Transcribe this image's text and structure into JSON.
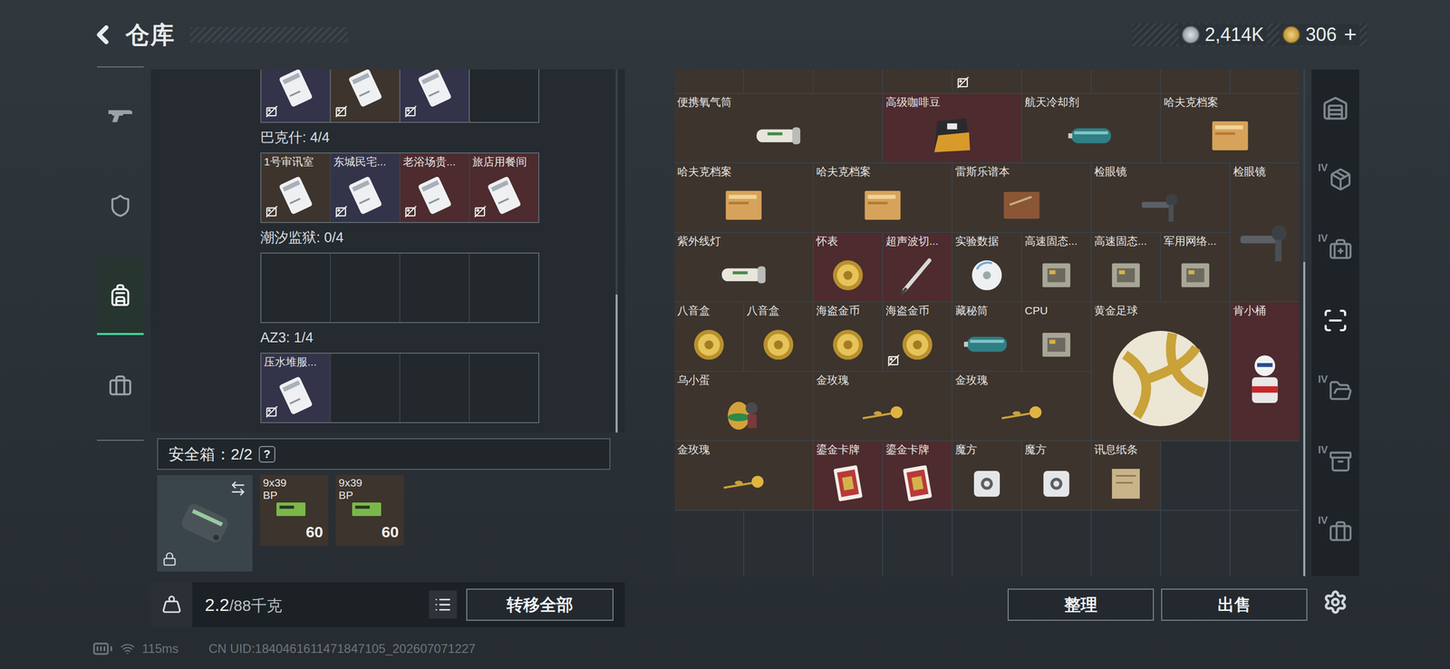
{
  "header": {
    "title": "仓库"
  },
  "currency": [
    {
      "value": "2,414K",
      "kind": "silver"
    },
    {
      "value": "306",
      "kind": "gold",
      "action": "+"
    }
  ],
  "left_tabs": [
    {
      "selected": false
    },
    {
      "selected": false
    },
    {
      "selected": true
    },
    {
      "selected": false
    }
  ],
  "keycards": {
    "partial_row": [
      {
        "kind": "card",
        "color": "#33344a",
        "untradeable": true
      },
      {
        "kind": "card",
        "color": "#3d342d",
        "untradeable": true
      },
      {
        "kind": "card",
        "color": "#33344a",
        "untradeable": true
      },
      {
        "kind": "empty"
      }
    ],
    "groups": [
      {
        "title": "巴克什: 4/4",
        "slots": [
          {
            "kind": "card",
            "name": "1号审讯室",
            "color": "#3d342d",
            "untradeable": true
          },
          {
            "kind": "card",
            "name": "东城民宅...",
            "color": "#33344a",
            "untradeable": true
          },
          {
            "kind": "card",
            "name": "老浴场贵...",
            "color": "#4d2b2e",
            "untradeable": true
          },
          {
            "kind": "card",
            "name": "旅店用餐间",
            "color": "#4d2b2e",
            "untradeable": true
          }
        ]
      },
      {
        "title": "潮汐监狱: 0/4",
        "slots": [
          {
            "kind": "empty"
          },
          {
            "kind": "empty"
          },
          {
            "kind": "empty"
          },
          {
            "kind": "empty"
          }
        ]
      },
      {
        "title": "AZ3: 1/4",
        "slots": [
          {
            "kind": "card",
            "name": "压水堆服...",
            "color": "#33344a",
            "untradeable": true
          },
          {
            "kind": "empty"
          },
          {
            "kind": "empty"
          },
          {
            "kind": "empty"
          }
        ]
      }
    ],
    "scroll": {
      "thumb_start": 0.62,
      "thumb_end": 1
    }
  },
  "safe_box": {
    "title": "安全箱：2/2",
    "help": "?",
    "locked": true,
    "items": [
      {
        "name": "9x39 BP",
        "count": "60"
      },
      {
        "name": "9x39 BP",
        "count": "60"
      }
    ]
  },
  "inventory_bar": {
    "weight": "2.2",
    "capacity": "/88千克",
    "transfer": "转移全部"
  },
  "stash": {
    "partial_row": [
      {
        "color": "#3d342d",
        "untradeable": false
      },
      {
        "color": "#3d342d",
        "untradeable": false
      },
      {
        "color": "#3d342d",
        "untradeable": false
      },
      {
        "color": "#3d342d",
        "untradeable": false
      },
      {
        "color": "#3d342d",
        "untradeable": true
      },
      {
        "color": "#3d342d",
        "untradeable": false
      },
      {
        "color": "#3d342d",
        "untradeable": false
      },
      {
        "color": "#3d342d",
        "untradeable": false
      },
      {
        "color": "#3d342d",
        "untradeable": false
      }
    ],
    "items": [
      {
        "name": "便携氧气筒",
        "kind": "cylinder",
        "color": "#3d342d",
        "untradeable": false
      },
      {
        "name": "高级咖啡豆",
        "kind": "bag",
        "color": "#4d2b2e",
        "untradeable": false
      },
      {
        "name": "航天冷却剂",
        "kind": "tank",
        "color": "#3d342d",
        "untradeable": false
      },
      {
        "name": "哈夫克档案",
        "kind": "folder",
        "color": "#3d342d",
        "untradeable": false
      },
      {
        "name": "哈夫克档案",
        "kind": "folder",
        "color": "#3d342d",
        "untradeable": false
      },
      {
        "name": "哈夫克档案",
        "kind": "folder",
        "color": "#3d342d",
        "untradeable": false
      },
      {
        "name": "雷斯乐谱本",
        "kind": "book",
        "color": "#3d342d",
        "untradeable": false
      },
      {
        "name": "检眼镜",
        "kind": "scope",
        "color": "#3d342d",
        "untradeable": false
      },
      {
        "name": "检眼镜",
        "kind": "scope",
        "color": "#3d342d",
        "untradeable": false
      },
      {
        "name": "紫外线灯",
        "kind": "cylinder",
        "color": "#3d342d",
        "untradeable": false
      },
      {
        "name": "怀表",
        "kind": "coin",
        "color": "#4d2b2e",
        "untradeable": false
      },
      {
        "name": "超声波切...",
        "kind": "pen",
        "color": "#4d2b2e",
        "untradeable": false
      },
      {
        "name": "实验数据",
        "kind": "disc",
        "color": "#3d342d",
        "untradeable": false
      },
      {
        "name": "高速固态...",
        "kind": "chip",
        "color": "#3d342d",
        "untradeable": false
      },
      {
        "name": "高速固态...",
        "kind": "chip",
        "color": "#3d342d",
        "untradeable": false
      },
      {
        "name": "军用网络...",
        "kind": "chip",
        "color": "#3d342d",
        "untradeable": false
      },
      {
        "name": "八音盒",
        "kind": "coin",
        "color": "#3d342d",
        "untradeable": false
      },
      {
        "name": "八音盒",
        "kind": "coin",
        "color": "#3d342d",
        "untradeable": false
      },
      {
        "name": "海盗金币",
        "kind": "coin",
        "color": "#3d342d",
        "untradeable": false
      },
      {
        "name": "海盗金币",
        "kind": "coin",
        "color": "#3d342d",
        "untradeable": true
      },
      {
        "name": "藏秘筒",
        "kind": "tank",
        "color": "#3d342d",
        "untradeable": false
      },
      {
        "name": "CPU",
        "kind": "chip",
        "color": "#3d342d",
        "untradeable": false
      },
      {
        "name": "黄金足球",
        "kind": "ball",
        "color": "#3d342d",
        "untradeable": false
      },
      {
        "name": "肯小桶",
        "kind": "figure",
        "color": "#4d2b2e",
        "untradeable": false
      },
      {
        "name": "乌小蛋",
        "kind": "egg",
        "color": "#3d342d",
        "untradeable": false
      },
      {
        "name": "金玫瑰",
        "kind": "rose",
        "color": "#3d342d",
        "untradeable": false
      },
      {
        "name": "金玫瑰",
        "kind": "rose",
        "color": "#3d342d",
        "untradeable": false
      },
      {
        "name": "金玫瑰",
        "kind": "rose",
        "color": "#3d342d",
        "untradeable": false
      },
      {
        "name": "鎏金卡牌",
        "kind": "card",
        "color": "#4d2b2e",
        "untradeable": false
      },
      {
        "name": "鎏金卡牌",
        "kind": "card",
        "color": "#4d2b2e",
        "untradeable": false
      },
      {
        "name": "魔方",
        "kind": "cube",
        "color": "#3d342d",
        "untradeable": false
      },
      {
        "name": "魔方",
        "kind": "cube",
        "color": "#3d342d",
        "untradeable": false
      },
      {
        "name": "讯息纸条",
        "kind": "paper",
        "color": "#3d342d",
        "untradeable": false
      }
    ],
    "scroll": {
      "thumb_start": 0.38,
      "thumb_end": 1
    }
  },
  "actions": [
    "整理",
    "出售"
  ],
  "right_tabs": [
    {
      "selected": false
    },
    {
      "badge": "IV",
      "selected": false
    },
    {
      "badge": "IV",
      "selected": false
    },
    {
      "selected": true
    },
    {
      "badge": "IV",
      "selected": false
    },
    {
      "badge": "IV",
      "selected": false
    },
    {
      "badge": "IV",
      "selected": false
    }
  ],
  "footer": {
    "ping": "115ms",
    "uid": "CN UID:1840461611471847105_202607071227"
  }
}
